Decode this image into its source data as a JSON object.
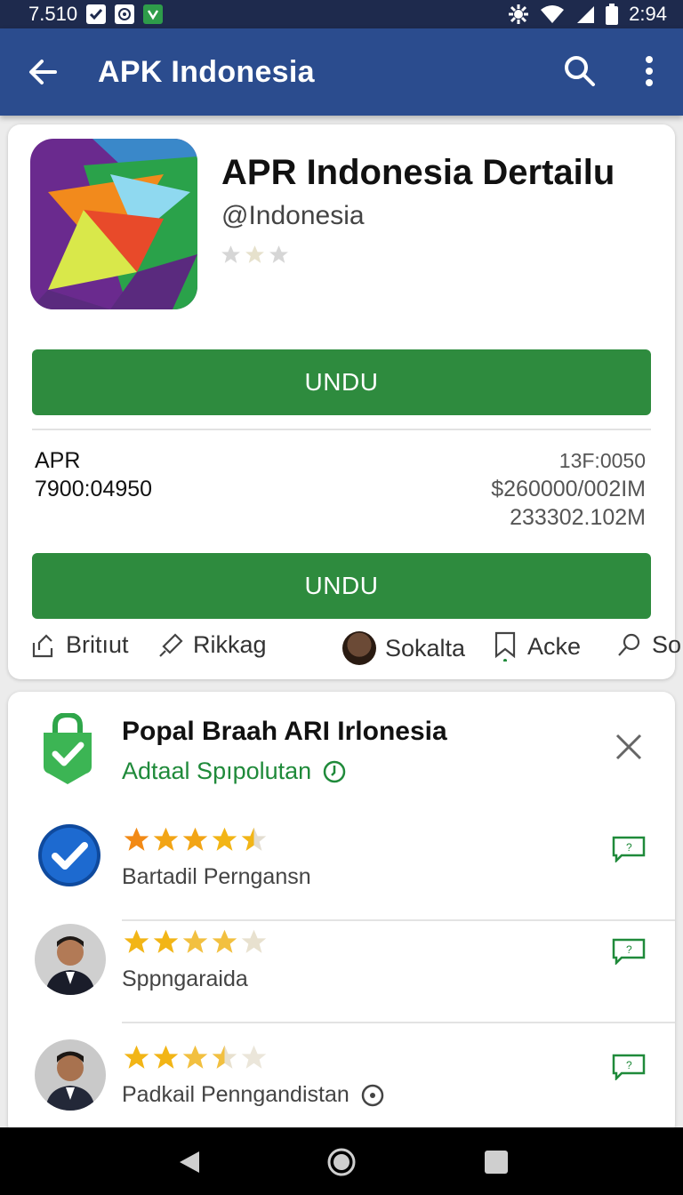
{
  "status_bar": {
    "left_text": "7.510",
    "time": "2:94"
  },
  "app_bar": {
    "title": "APK Indonesia"
  },
  "app": {
    "title": "APR Indonesia Dertailu",
    "developer": "@Indonesia",
    "rating_stars": 3,
    "install_label_1": "UNDU",
    "install_label_2": "UNDU",
    "info_left_line1": "APR",
    "info_left_line2": "7900:04950",
    "info_right_line1": "13F:0050",
    "info_right_line2": "$260000/002IM",
    "info_right_line3": "233302.102M",
    "actions": [
      {
        "label": "Britıut",
        "icon": "share-icon"
      },
      {
        "label": "Rikkag",
        "icon": "pin-icon"
      },
      {
        "label": "Sokalta",
        "icon": "avatar"
      },
      {
        "label": "Acke",
        "icon": "bookmark-icon"
      },
      {
        "label": "So",
        "icon": "search-icon"
      }
    ]
  },
  "security": {
    "title": "Popal Braah ARI Irlonesia",
    "subtitle": "Adtaal Spıpolutan"
  },
  "reviews": [
    {
      "name": "Bartadil Perngansn",
      "stars": 4.5,
      "avatar": "verified-badge-icon"
    },
    {
      "name": "Sppngaraida",
      "stars": 4,
      "avatar": "user-avatar"
    },
    {
      "name": "Padkail Penngandistan",
      "stars": 3.5,
      "avatar": "user-avatar"
    }
  ],
  "colors": {
    "status_bar": "#1e2a4d",
    "app_bar": "#2b4c8e",
    "install_button": "#2e8b3e",
    "accent_green": "#1f8a3a",
    "star": "#f2a516"
  }
}
